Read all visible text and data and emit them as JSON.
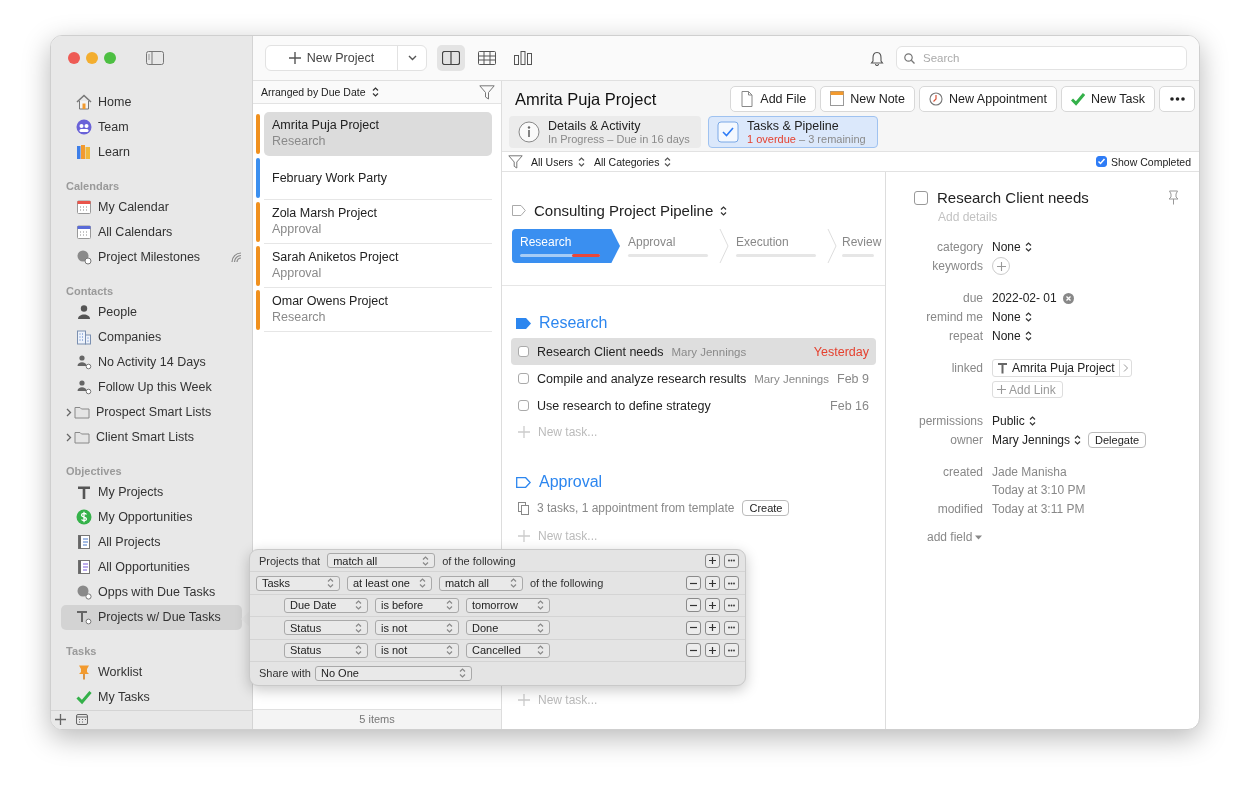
{
  "sidebar": {
    "sections": [
      {
        "items": [
          {
            "label": "Home",
            "kind": "list",
            "selected": false,
            "shared": false
          },
          {
            "label": "Team",
            "kind": "list",
            "selected": false,
            "shared": false
          },
          {
            "label": "Learn",
            "kind": "list",
            "selected": false,
            "shared": false
          }
        ]
      },
      {
        "title": "Calendars",
        "items": [
          {
            "label": "My Calendar",
            "kind": "list",
            "selected": false,
            "shared": false
          },
          {
            "label": "All Calendars",
            "kind": "list",
            "selected": false,
            "shared": false
          },
          {
            "label": "Project Milestones",
            "kind": "list",
            "selected": false,
            "shared": true
          }
        ]
      },
      {
        "title": "Contacts",
        "items": [
          {
            "label": "People",
            "kind": "list",
            "selected": false,
            "shared": false
          },
          {
            "label": "Companies",
            "kind": "list",
            "selected": false,
            "shared": false
          },
          {
            "label": "No Activity 14 Days",
            "kind": "list",
            "selected": false,
            "shared": false
          },
          {
            "label": "Follow Up this Week",
            "kind": "list",
            "selected": false,
            "shared": false
          },
          {
            "label": "Prospect Smart Lists",
            "kind": "folder",
            "expanded": false,
            "selected": false,
            "shared": false
          },
          {
            "label": "Client Smart Lists",
            "kind": "folder",
            "expanded": false,
            "selected": false,
            "shared": false
          }
        ]
      },
      {
        "title": "Objectives",
        "items": [
          {
            "label": "My Projects",
            "kind": "list",
            "selected": false,
            "shared": false
          },
          {
            "label": "My Opportunities",
            "kind": "list",
            "selected": false,
            "shared": false
          },
          {
            "label": "All Projects",
            "kind": "list",
            "selected": false,
            "shared": false
          },
          {
            "label": "All Opportunities",
            "kind": "list",
            "selected": false,
            "shared": false
          },
          {
            "label": "Opps with Due Tasks",
            "kind": "list",
            "selected": false,
            "shared": false
          },
          {
            "label": "Projects w/ Due Tasks",
            "kind": "list",
            "selected": true,
            "shared": false
          }
        ]
      },
      {
        "title": "Tasks",
        "items": [
          {
            "label": "Worklist",
            "kind": "list",
            "selected": false,
            "shared": false
          },
          {
            "label": "My Tasks",
            "kind": "list",
            "selected": false,
            "shared": false
          }
        ]
      }
    ]
  },
  "toolbar": {
    "new_button": "New Project",
    "views": [
      {
        "selected": true
      },
      {
        "selected": false
      },
      {
        "selected": false
      }
    ],
    "search": {
      "placeholder": "Search"
    }
  },
  "list": {
    "sort": "Arranged by Due Date",
    "items": [
      {
        "title": "Amrita Puja Project",
        "subtitle": "Research",
        "color": "#f0901e",
        "selected": true
      },
      {
        "title": "February Work Party",
        "color": "#3b8fef",
        "selected": false
      },
      {
        "title": "Zola Marsh Project",
        "subtitle": "Approval",
        "color": "#f0901e",
        "selected": false
      },
      {
        "title": "Sarah Aniketos Project",
        "subtitle": "Approval",
        "color": "#f0901e",
        "selected": false
      },
      {
        "title": "Omar Owens Project",
        "subtitle": "Research",
        "color": "#f0901e",
        "selected": false
      }
    ],
    "footer": "5 items"
  },
  "detail": {
    "title": "Amrita Puja Project",
    "actions": [
      "Add File",
      "New Note",
      "New Appointment",
      "New Task"
    ],
    "tabs": [
      {
        "title": "Details & Activity",
        "subtitle": "In Progress – Due in 16 days",
        "selected": false
      },
      {
        "title": "Tasks & Pipeline",
        "alert": "1 overdue",
        "subtitle": "– 3 remaining",
        "selected": true
      }
    ],
    "filters": [
      "All Users",
      "All Categories"
    ],
    "show_completed": {
      "label": "Show Completed",
      "checked": true
    },
    "pipeline": {
      "name": "Consulting Project Pipeline",
      "stages": [
        {
          "label": "Research",
          "selected": true,
          "level": 0.35
        },
        {
          "label": "Approval",
          "selected": false
        },
        {
          "label": "Execution",
          "selected": false
        },
        {
          "label": "Review",
          "selected": false
        }
      ]
    },
    "sections": [
      {
        "name": "Research",
        "current": true,
        "tasks": [
          {
            "title": "Research Client needs",
            "owner": "Mary Jennings",
            "due": "Yesterday",
            "overdue": true,
            "checked": false,
            "selected": true
          },
          {
            "title": "Compile and analyze research results",
            "owner": "Mary Jennings",
            "due": "Feb 9",
            "overdue": false,
            "checked": false,
            "selected": false
          },
          {
            "title": "Use research to define strategy",
            "due": "Feb 16",
            "overdue": false,
            "checked": false,
            "selected": false
          }
        ],
        "new_task": "New task..."
      },
      {
        "name": "Approval",
        "current": false,
        "template": {
          "text": "3 tasks, 1 appointment from template",
          "button": "Create"
        },
        "new_task": "New task..."
      },
      {
        "new_task": "New task..."
      }
    ]
  },
  "task": {
    "title": "Research Client needs",
    "checked": false,
    "placeholder": "Add details",
    "field_groups": [
      [
        {
          "label": "category",
          "kind": "popup",
          "value": "None"
        },
        {
          "label": "keywords",
          "kind": "add"
        }
      ],
      [
        {
          "label": "due",
          "kind": "date",
          "value": "2022-02- 01"
        },
        {
          "label": "remind me",
          "kind": "popup",
          "value": "None"
        },
        {
          "label": "repeat",
          "kind": "popup",
          "value": "None"
        }
      ],
      [
        {
          "label": "linked",
          "kind": "link",
          "value": "Amrita Puja Project",
          "button": "Add Link"
        }
      ],
      [
        {
          "label": "permissions",
          "kind": "popup",
          "value": "Public"
        },
        {
          "label": "owner",
          "kind": "popup",
          "value": "Mary Jennings",
          "button": "Delegate"
        }
      ],
      [
        {
          "label": "created",
          "kind": "text",
          "lines": [
            "Jade Manisha",
            "Today at 3:10 PM"
          ]
        },
        {
          "label": "modified",
          "kind": "text",
          "lines": [
            "Today at 3:11 PM"
          ]
        }
      ]
    ],
    "add_field": "add field"
  },
  "popover": {
    "rows": [
      {
        "parts": [
          {
            "kind": "label",
            "text": "Projects that"
          },
          {
            "kind": "popup",
            "text": "match all"
          },
          {
            "kind": "label",
            "text": "of the following"
          }
        ],
        "removable": false,
        "children": [
          {
            "parts": [
              {
                "kind": "popup",
                "text": "Tasks"
              },
              {
                "kind": "popup",
                "text": "at least one"
              },
              {
                "kind": "popup",
                "text": "match all"
              },
              {
                "kind": "label",
                "text": "of the following"
              }
            ],
            "removable": true,
            "children": [
              {
                "parts": [
                  {
                    "kind": "popup",
                    "text": "Due Date"
                  },
                  {
                    "kind": "popup",
                    "text": "is before"
                  },
                  {
                    "kind": "popup",
                    "text": "tomorrow"
                  }
                ],
                "removable": true
              },
              {
                "parts": [
                  {
                    "kind": "popup",
                    "text": "Status"
                  },
                  {
                    "kind": "popup",
                    "text": "is not"
                  },
                  {
                    "kind": "popup",
                    "text": "Done"
                  }
                ],
                "removable": true
              },
              {
                "parts": [
                  {
                    "kind": "popup",
                    "text": "Status"
                  },
                  {
                    "kind": "popup",
                    "text": "is not"
                  },
                  {
                    "kind": "popup",
                    "text": "Cancelled"
                  }
                ],
                "removable": true
              }
            ]
          }
        ]
      }
    ],
    "share": {
      "label": "Share with",
      "value": "No One"
    }
  }
}
